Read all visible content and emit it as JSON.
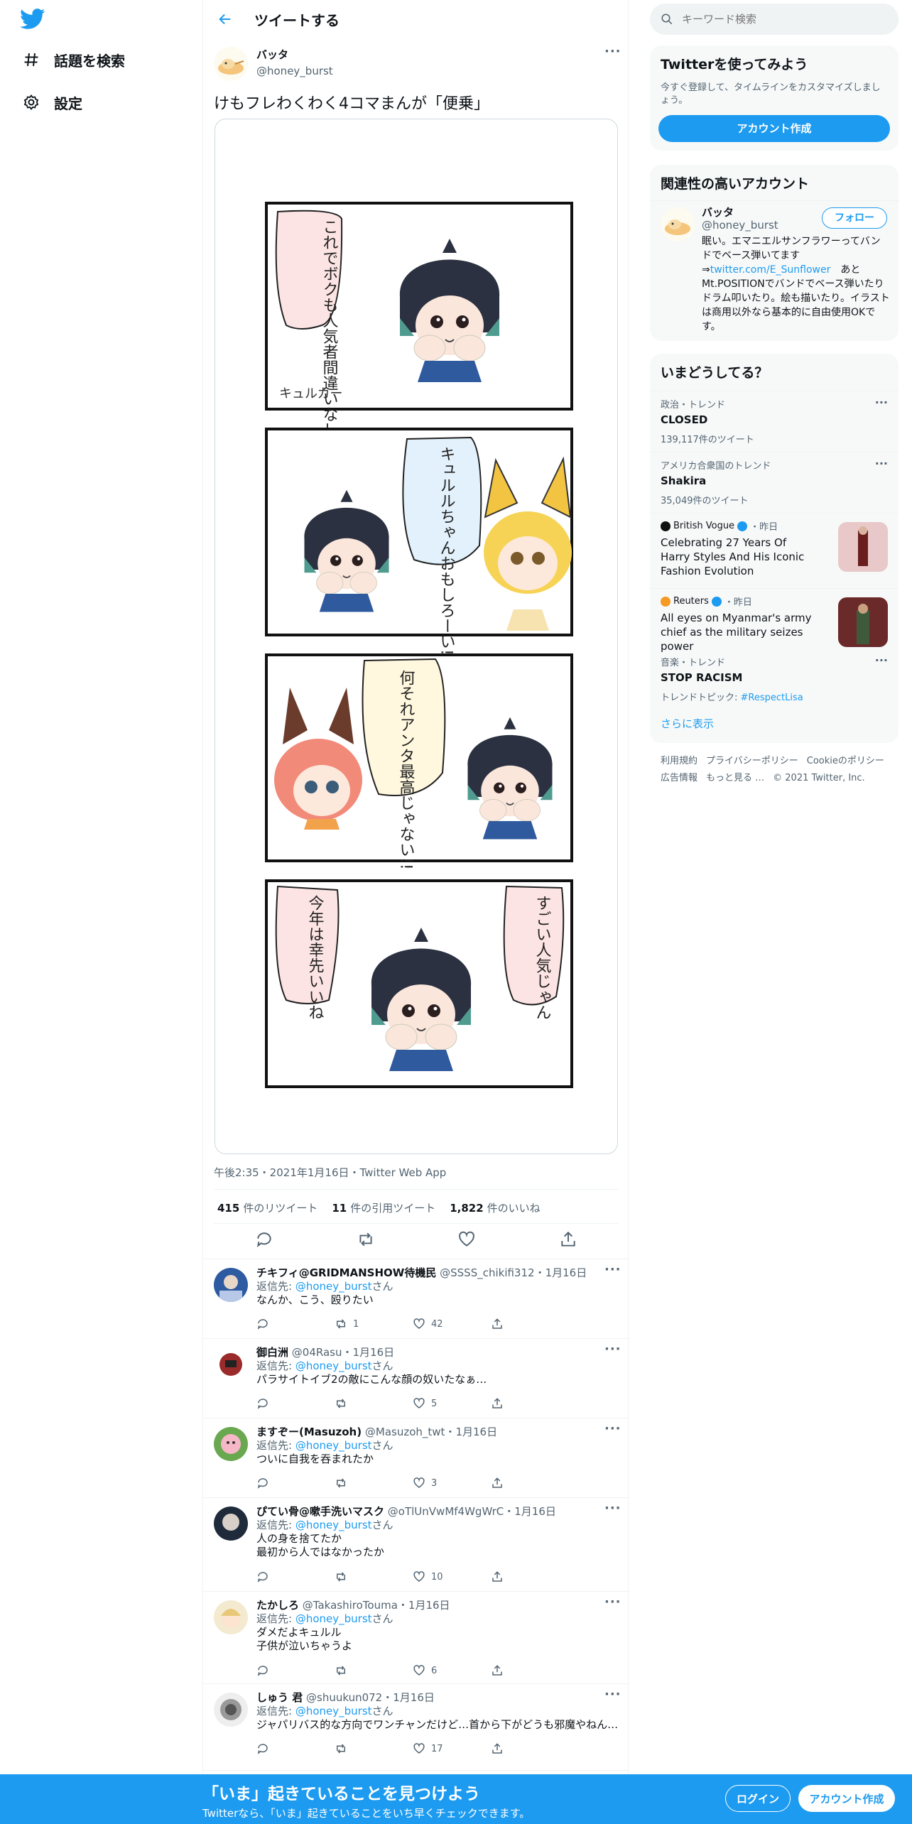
{
  "nav": {
    "items": [
      {
        "label": "話題を検索",
        "icon": "hashtag-icon"
      },
      {
        "label": "設定",
        "icon": "gear-icon"
      }
    ]
  },
  "header": {
    "title": "ツイートする"
  },
  "tweet": {
    "author_name": "バッタ",
    "author_handle": "@honey_burst",
    "text": "けもフレわくわく4コマまんが「便乗」",
    "meta": "午後2:35・2021年1月16日・Twitter Web App",
    "stats": {
      "retweets_num": "415",
      "retweets_label": "件のリツイート",
      "quotes_num": "11",
      "quotes_label": "件の引用ツイート",
      "likes_num": "1,822",
      "likes_label": "件のいいね"
    },
    "comic": {
      "panel1": "これでボクも人気者間違いなし",
      "brand": "キュルカー",
      "panel2": "キュルルちゃんおもしろーい!!",
      "panel3": "何それアンタ最高じゃない!!",
      "panel4_left": "今年は幸先いいね",
      "panel4_right": "すごい人気じゃん"
    }
  },
  "replies": [
    {
      "name": "チキフィ@GRIDMANSHOW待機民",
      "handle": "@SSSS_chikifi312",
      "date": "1月16日",
      "reply_prefix": "返信先:",
      "reply_to": "@honey_burst",
      "reply_suffix": "さん",
      "text": "なんか、こう、殴りたい",
      "rt": "1",
      "likes": "42"
    },
    {
      "name": "御白洲",
      "handle": "@04Rasu",
      "date": "1月16日",
      "reply_prefix": "返信先:",
      "reply_to": "@honey_burst",
      "reply_suffix": "さん",
      "text": "パラサイトイブ2の敵にこんな顔の奴いたなぁ…",
      "rt": "",
      "likes": "5"
    },
    {
      "name": "ますぞー(Masuzoh)",
      "handle": "@Masuzoh_twt",
      "date": "1月16日",
      "reply_prefix": "返信先:",
      "reply_to": "@honey_burst",
      "reply_suffix": "さん",
      "text": "ついに自我を吞まれたか",
      "rt": "",
      "likes": "3"
    },
    {
      "name": "ぴてい骨@嗽手洗いマスク",
      "handle": "@oTlUnVwMf4WgWrC",
      "date": "1月16日",
      "reply_prefix": "返信先:",
      "reply_to": "@honey_burst",
      "reply_suffix": "さん",
      "text": "人の身を捨てたか",
      "text2": "最初から人ではなかったか",
      "rt": "",
      "likes": "10"
    },
    {
      "name": "たかしろ",
      "handle": "@TakashiroTouma",
      "date": "1月16日",
      "reply_prefix": "返信先:",
      "reply_to": "@honey_burst",
      "reply_suffix": "さん",
      "text": "ダメだよキュルル",
      "text2": "子供が泣いちゃうよ",
      "rt": "",
      "likes": "6"
    },
    {
      "name": "しゅう 君",
      "handle": "@shuukun072",
      "date": "1月16日",
      "reply_prefix": "返信先:",
      "reply_to": "@honey_burst",
      "reply_suffix": "さん",
      "text": "ジャパリバス的な方向でワンチャンだけど…首から下がどうも邪魔やねん…",
      "rt": "",
      "likes": "17"
    }
  ],
  "search": {
    "placeholder": "キーワード検索"
  },
  "signup_card": {
    "title": "Twitterを使ってみよう",
    "desc": "今すぐ登録して、タイムラインをカスタマイズしましょう。",
    "button": "アカウント作成"
  },
  "relevant": {
    "title": "関連性の高いアカウント",
    "name": "バッタ",
    "handle": "@honey_burst",
    "follow": "フォロー",
    "bio1": "眠い。エマニエルサンフラワーってバンドでベース弾いてます",
    "bio_link_prefix": "⇒",
    "bio_link": "twitter.com/E_Sunflower",
    "bio2": "　あとMt.POSITIONでバンドでベース弾いたりドラム叩いたり。絵も描いたり。イラストは商用以外なら基本的に自由使用OKです。"
  },
  "trends": {
    "title": "いまどうしてる？",
    "items": [
      {
        "cat": "政治・トレンド",
        "title": "CLOSED",
        "count": "139,117件のツイート"
      },
      {
        "cat": "アメリカ合衆国のトレンド",
        "title": "Shakira",
        "count": "35,049件のツイート"
      },
      {
        "source": "British Vogue",
        "time": "・昨日",
        "title": "Celebrating 27 Years Of Harry Styles And His Iconic Fashion Evolution"
      },
      {
        "source": "Reuters",
        "time": "・昨日",
        "title": "All eyes on Myanmar's army chief as the military seizes power"
      },
      {
        "cat": "音楽・トレンド",
        "title": "STOP RACISM",
        "topic_prefix": "トレンドトピック: ",
        "topic": "#RespectLisa"
      }
    ],
    "more": "さらに表示"
  },
  "footer": {
    "links": [
      "利用規約",
      "プライバシーポリシー",
      "Cookieのポリシー",
      "広告情報",
      "もっと見る …"
    ],
    "copyright": "© 2021 Twitter, Inc."
  },
  "bottom_bar": {
    "title": "「いま」起きていることを見つけよう",
    "subtitle": "Twitterなら、「いま」起きていることをいち早くチェックできます。",
    "login": "ログイン",
    "signup": "アカウント作成"
  },
  "colors": {
    "accent": "#1d9bf0",
    "muted": "#536471",
    "card_bg": "#f7f9f9"
  }
}
